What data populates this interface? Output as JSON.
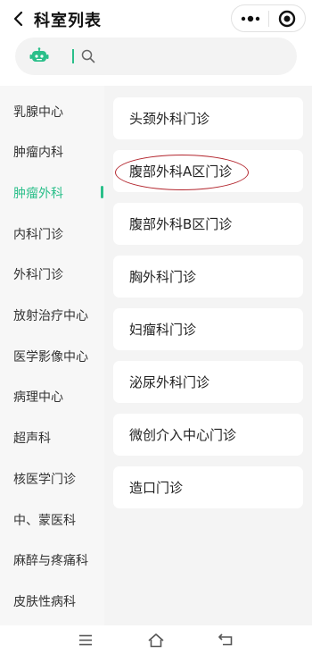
{
  "header": {
    "title": "科室列表",
    "back_icon": "chevron-left-icon",
    "more_icon": "more-dots-icon",
    "close_icon": "target-circle-icon"
  },
  "search": {
    "placeholder": "",
    "bot_icon": "robot-icon",
    "search_icon": "search-icon",
    "accent": "#2bbf8a"
  },
  "sidebar": {
    "active_index": 2,
    "items": [
      {
        "label": "乳腺中心"
      },
      {
        "label": "肿瘤内科"
      },
      {
        "label": "肿瘤外科"
      },
      {
        "label": "内科门诊"
      },
      {
        "label": "外科门诊"
      },
      {
        "label": "放射治疗中心"
      },
      {
        "label": "医学影像中心"
      },
      {
        "label": "病理中心"
      },
      {
        "label": "超声科"
      },
      {
        "label": "核医学门诊"
      },
      {
        "label": "中、蒙医科"
      },
      {
        "label": "麻醉与疼痛科"
      },
      {
        "label": "皮肤性病科"
      }
    ]
  },
  "clinics": {
    "items": [
      {
        "label": "头颈外科门诊"
      },
      {
        "label": "腹部外科A区门诊"
      },
      {
        "label": "腹部外科B区门诊"
      },
      {
        "label": "胸外科门诊"
      },
      {
        "label": "妇瘤科门诊"
      },
      {
        "label": "泌尿外科门诊"
      },
      {
        "label": "微创介入中心门诊"
      },
      {
        "label": "造口门诊"
      }
    ],
    "highlighted_index": 1,
    "highlight_color": "#b3262e"
  },
  "system_nav": {
    "menu_icon": "menu-icon",
    "home_icon": "home-icon",
    "back_icon": "back-return-icon"
  }
}
